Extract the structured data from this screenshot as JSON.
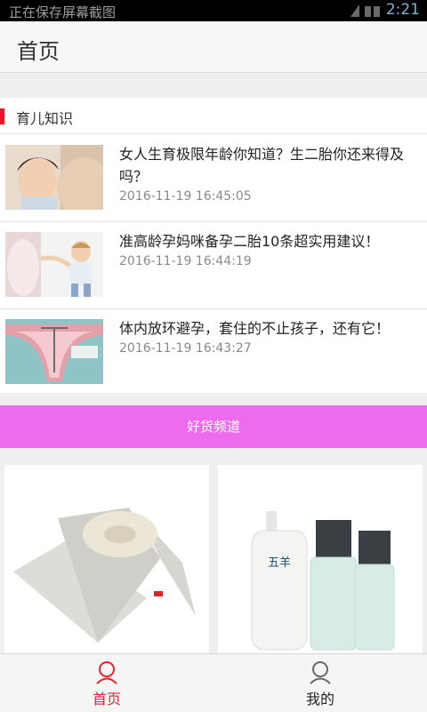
{
  "status": {
    "notification": "正在保存屏幕截图",
    "time": "2:21"
  },
  "header": {
    "title": "首页"
  },
  "knowledge": {
    "heading": "育儿知识",
    "articles": [
      {
        "title": "女人生育极限年龄你知道？生二胎你还来得及吗？",
        "date": "2016-11-19 16:45:05"
      },
      {
        "title": "准高龄孕妈咪备孕二胎10条超实用建议！",
        "date": "2016-11-19 16:44:19"
      },
      {
        "title": "体内放环避孕，套住的不止孩子，还有它！",
        "date": "2016-11-19 16:43:27"
      }
    ]
  },
  "channel": {
    "label": "好货频道"
  },
  "products": [
    {
      "image": "baby-sleep-positioner"
    },
    {
      "image": "cosmetic-bottles",
      "brand": "五羊"
    }
  ],
  "tabs": [
    {
      "label": "首页",
      "active": true
    },
    {
      "label": "我的",
      "active": false
    }
  ],
  "colors": {
    "accent": "#e8152b",
    "banner": "#ee6bee"
  }
}
